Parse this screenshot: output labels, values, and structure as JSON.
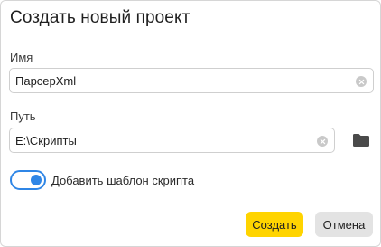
{
  "dialog": {
    "title": "Создать новый проект"
  },
  "name_field": {
    "label": "Имя",
    "value": "ПарсерXml"
  },
  "path_field": {
    "label": "Путь",
    "value": "E:\\Скрипты"
  },
  "template_toggle": {
    "label": "Добавить шаблон скрипта",
    "checked": true
  },
  "buttons": {
    "create_label": "Создать",
    "cancel_label": "Отмена"
  },
  "icons": {
    "clear": "clear-icon",
    "folder": "folder-icon"
  },
  "colors": {
    "accent": "#2f86e6",
    "primary_button": "#ffd400",
    "secondary_button": "#e3e3e3"
  }
}
